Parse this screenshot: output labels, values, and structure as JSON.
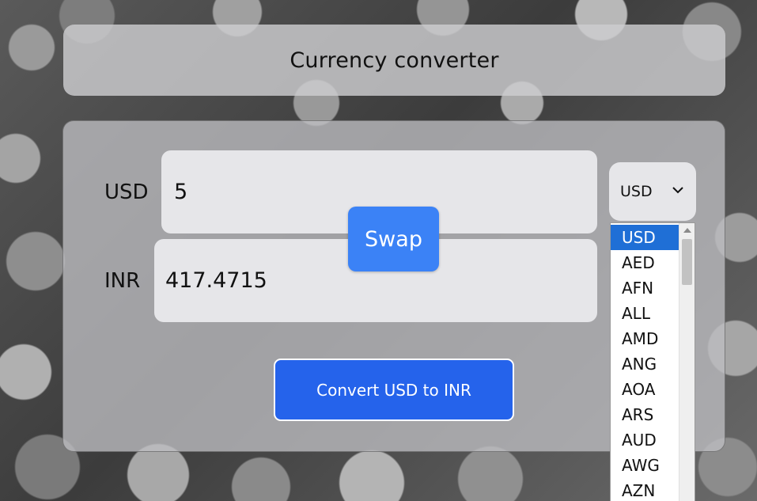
{
  "header": {
    "title": "Currency converter"
  },
  "from": {
    "label": "USD",
    "amount": "5"
  },
  "to": {
    "label": "INR",
    "amount": "417.4715"
  },
  "swap_label": "Swap",
  "currency_select": {
    "selected": "USD",
    "options": [
      "USD",
      "AED",
      "AFN",
      "ALL",
      "AMD",
      "ANG",
      "AOA",
      "ARS",
      "AUD",
      "AWG",
      "AZN"
    ]
  },
  "convert_label": "Convert USD to INR",
  "colors": {
    "swap_button": "#3b82f6",
    "convert_button": "#2563eb",
    "selected_option": "#1f6fd6"
  }
}
